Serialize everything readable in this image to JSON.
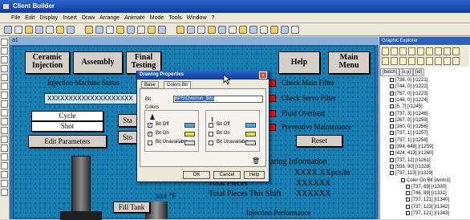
{
  "app": {
    "title": "Client Builder",
    "menu": [
      "File",
      "Edit",
      "Display",
      "Insert",
      "Draw",
      "Arrange",
      "Animate",
      "Mode",
      "Tools",
      "Window",
      "?"
    ],
    "child_title": "a1"
  },
  "hmi": {
    "tabs": [
      {
        "label": "Ceramic Injection"
      },
      {
        "label": "Assembly"
      },
      {
        "label": "Final Testing"
      },
      {
        "label": "Help"
      },
      {
        "label": "Main Menu"
      }
    ],
    "machine_status_label": "Injection Machine Status",
    "status_text": "XXXXXXXXXXXXXXXXXXXX",
    "cycle_label": "Cycle",
    "shot_label": "Shot",
    "edit_parameters_label": "Edit Parameters",
    "start_label": "Sta",
    "stop_label": "Sto",
    "temp_unit": "xxx °F",
    "fill_tank_label": "Fill Tank",
    "alarms": [
      "Check Main Filter",
      "Check Servo Filter",
      "Fluid Overheat",
      "Preventive Maintenance"
    ],
    "reset_label": "Reset",
    "sharing_info_label": "aring Information",
    "pieces_per_hr": "XXXX.XXpcs/hr",
    "pieces_value_1": "XXXXXX",
    "pieces_value_2": "XXXXXX",
    "total_pieces_label": "Total Pieces",
    "total_pieces_shift_label": "Total Pieces This Shift",
    "injection_performance_label": "Injection Performance"
  },
  "dialog": {
    "title": "Drawing Properties",
    "tabs": [
      "Base",
      "Colors Bit"
    ],
    "bit_label": "Bit",
    "bit_value": "BPS\\Overrun_Bits",
    "colors_label": "Colors",
    "left_items": [
      {
        "label": "Bit Off",
        "checked": true,
        "color": "#4aa6e6"
      },
      {
        "label": "Bit On",
        "checked": true,
        "color": "#f0e020"
      },
      {
        "label": "Bit Unavailable",
        "checked": false,
        "color": "#d8d8d8"
      }
    ],
    "right_items": [
      {
        "label": "Bit Off",
        "checked": false,
        "color": "#4aa6e6"
      },
      {
        "label": "Bit On",
        "checked": false,
        "color": "#f0e020"
      },
      {
        "label": "Bit Unavailable",
        "checked": false,
        "color": "#d8d8d8"
      }
    ],
    "ok_label": "OK",
    "cancel_label": "Cancel",
    "help_label": "Help"
  },
  "explorer": {
    "title": "Graphic Explorer",
    "columns": [
      "[batch]",
      "[x,y]",
      "[id]"
    ],
    "items": [
      "[738, 0] [r1221]",
      "[744, 0] [r1222]",
      "[757, 0] [r1223]",
      "[146, 0] [r1224]",
      "[5, 7] [r1245]",
      "[737, 3] [r1246]",
      "[267, 0] [r1259]",
      "[160, 0] [r1256]",
      "[737, 1] [r1257]",
      "[737, 1] [r1258]",
      "[394, 648] [r1259]",
      "[424, 413] [r1260]",
      "[737, 12] [r1261]",
      "[556, 90] [r1328]",
      "[737, 113] [r1329]",
      "Color On Bit [Anim1]",
      "[737, 89] [r1330]",
      "[746, 89] [r1331]",
      "[737, 121] [r1340]",
      "[737, 123] [r1342]",
      "[737, 121] [r1343]"
    ]
  }
}
